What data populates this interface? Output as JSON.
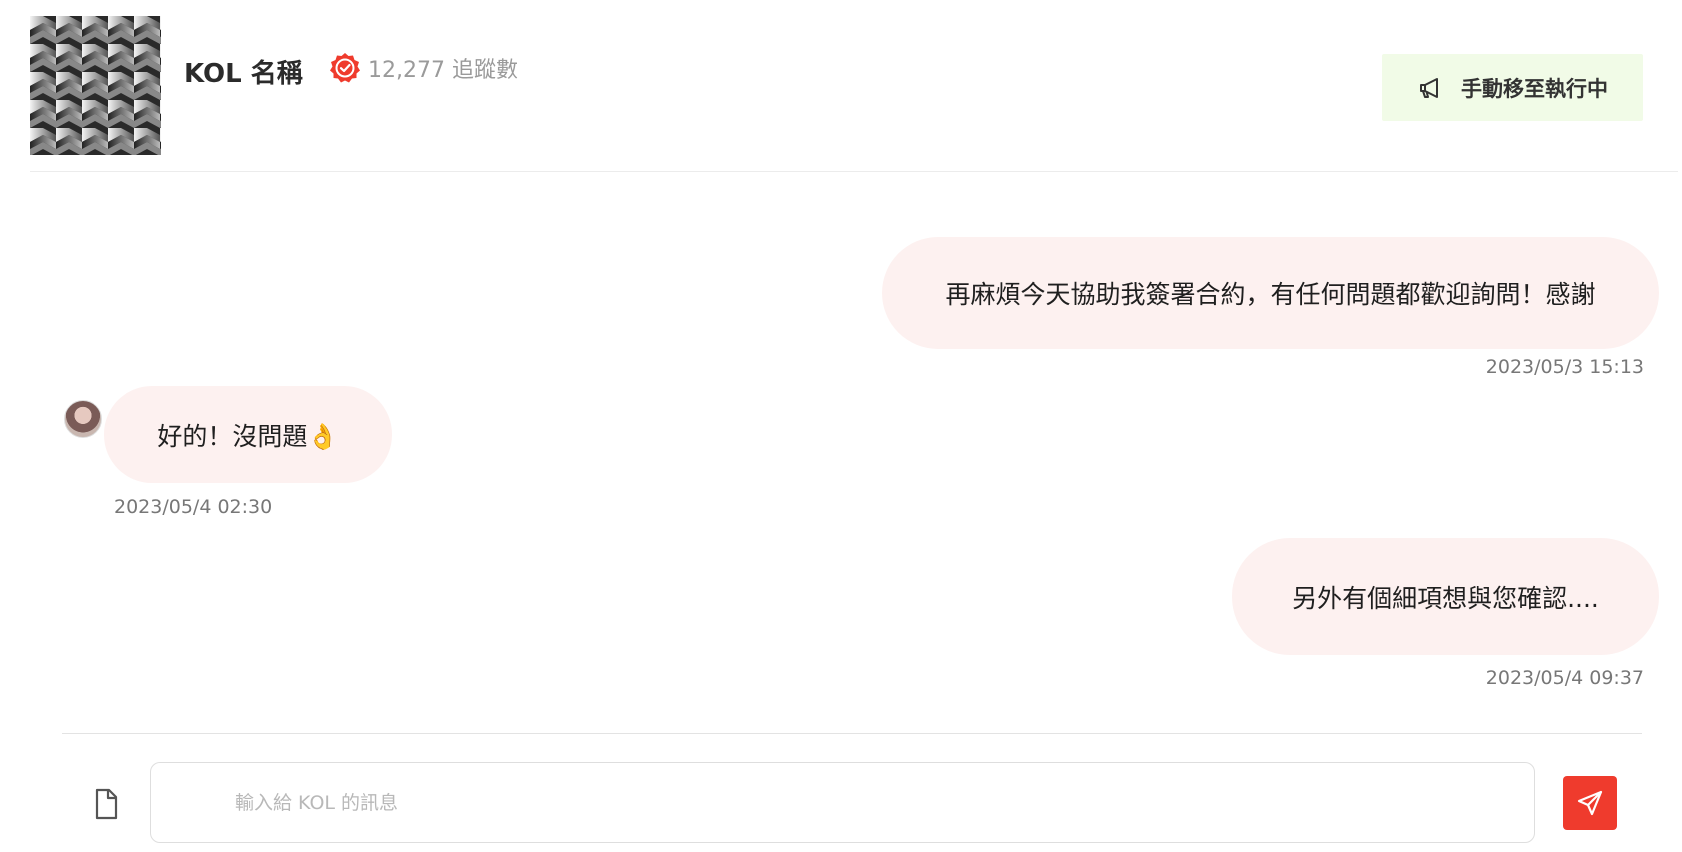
{
  "header": {
    "kol_name": "KOL 名稱",
    "followers": "12,277 追蹤數",
    "action_button": "手動移至執行中",
    "verified_icon": "verified-badge-icon",
    "action_icon": "megaphone-icon"
  },
  "messages": [
    {
      "direction": "outgoing",
      "text": "再麻煩今天協助我簽署合約，有任何問題都歡迎詢問！感謝",
      "timestamp": "2023/05/3 15:13"
    },
    {
      "direction": "incoming",
      "text": "好的！沒問題👌",
      "timestamp": "2023/05/4 02:30"
    },
    {
      "direction": "outgoing",
      "text": "另外有個細項想與您確認....",
      "timestamp": "2023/05/4 09:37"
    }
  ],
  "composer": {
    "placeholder": "輸入給 KOL 的訊息",
    "value": "",
    "attach_icon": "file-icon",
    "send_icon": "send-icon"
  },
  "colors": {
    "accent": "#ef3b2d",
    "bubble": "#fdf1f0",
    "action_button_bg": "#f1fbe7",
    "verified": "#ef3b2d"
  }
}
